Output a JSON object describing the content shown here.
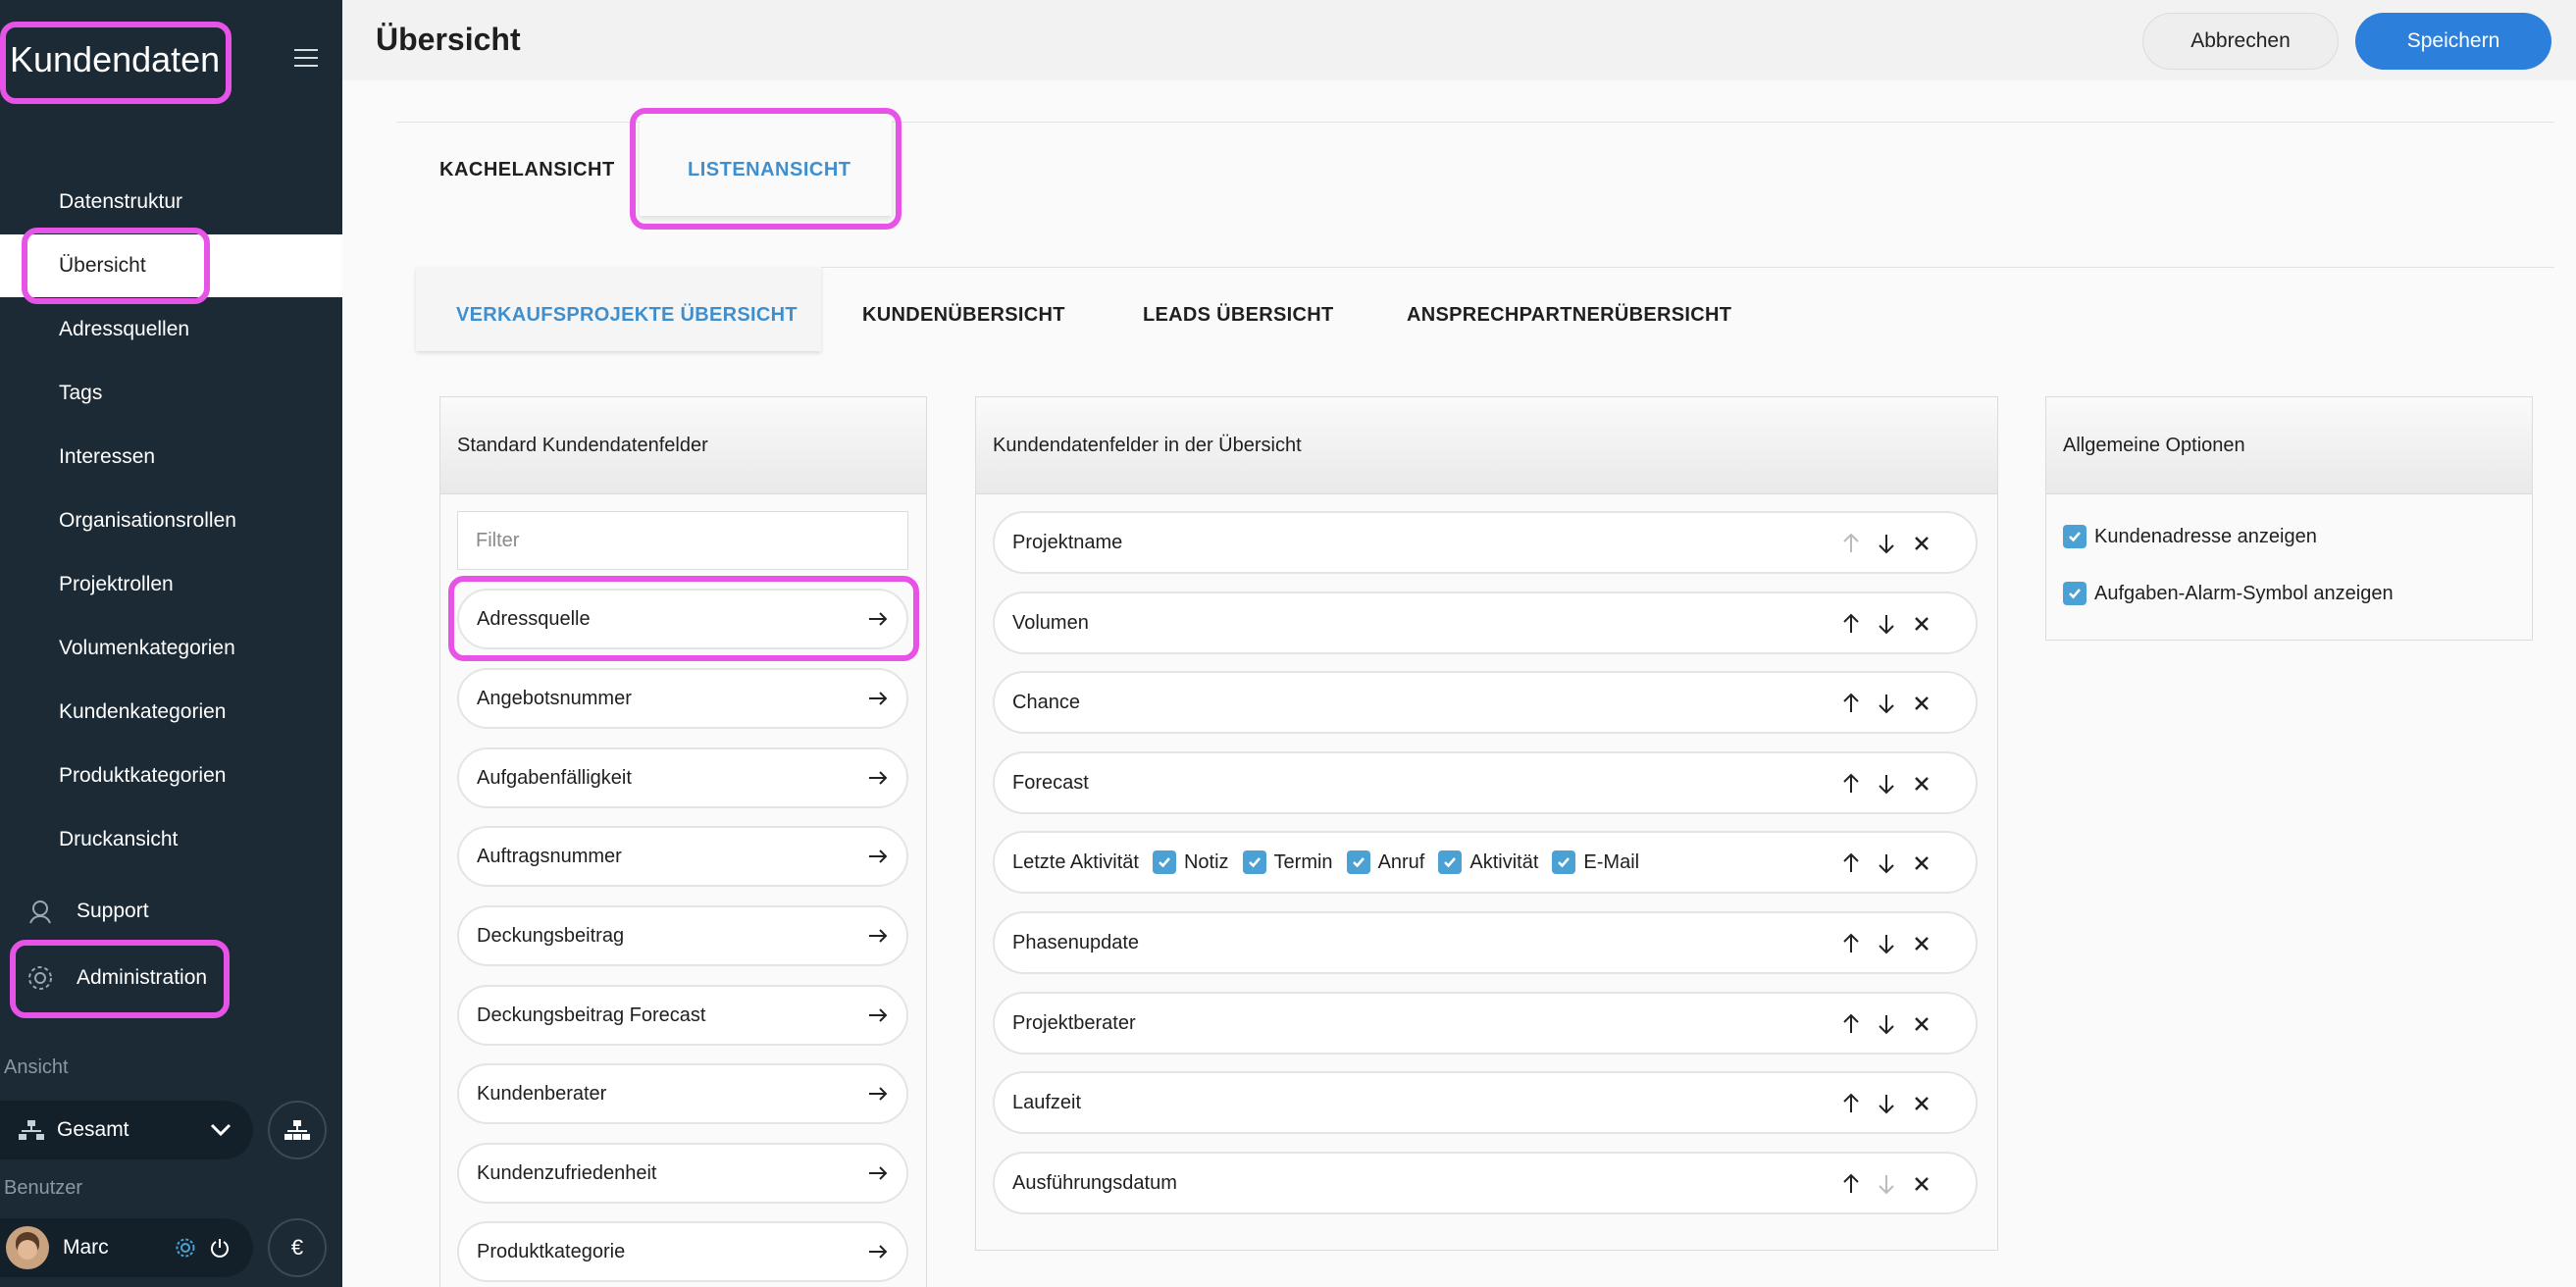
{
  "sidebar": {
    "app_title": "Kundendaten",
    "items": [
      {
        "label": "Datenstruktur"
      },
      {
        "label": "Übersicht"
      },
      {
        "label": "Adressquellen"
      },
      {
        "label": "Tags"
      },
      {
        "label": "Interessen"
      },
      {
        "label": "Organisationsrollen"
      },
      {
        "label": "Projektrollen"
      },
      {
        "label": "Volumenkategorien"
      },
      {
        "label": "Kundenkategorien"
      },
      {
        "label": "Produktkategorien"
      },
      {
        "label": "Druckansicht"
      }
    ],
    "support_label": "Support",
    "administration_label": "Administration",
    "view_label": "Ansicht",
    "view_value": "Gesamt",
    "user_section_label": "Benutzer",
    "user_name": "Marc",
    "currency_symbol": "€"
  },
  "header": {
    "title": "Übersicht",
    "cancel_label": "Abbrechen",
    "save_label": "Speichern"
  },
  "view_tabs": [
    {
      "label": "KACHELANSICHT"
    },
    {
      "label": "LISTENANSICHT",
      "active": true
    }
  ],
  "sub_tabs": [
    {
      "label": "VERKAUFSPROJEKTE ÜBERSICHT",
      "active": true
    },
    {
      "label": "KUNDENÜBERSICHT"
    },
    {
      "label": "LEADS ÜBERSICHT"
    },
    {
      "label": "ANSPRECHPARTNERÜBERSICHT"
    }
  ],
  "standard_panel": {
    "title": "Standard Kundendatenfelder",
    "filter_placeholder": "Filter",
    "items": [
      "Adressquelle",
      "Angebotsnummer",
      "Aufgabenfälligkeit",
      "Auftragsnummer",
      "Deckungsbeitrag",
      "Deckungsbeitrag Forecast",
      "Kundenberater",
      "Kundenzufriedenheit",
      "Produktkategorie"
    ]
  },
  "overview_panel": {
    "title": "Kundendatenfelder in der Übersicht",
    "items": [
      {
        "label": "Projektname"
      },
      {
        "label": "Volumen"
      },
      {
        "label": "Chance"
      },
      {
        "label": "Forecast"
      },
      {
        "label": "Letzte Aktivität",
        "options": [
          "Notiz",
          "Termin",
          "Anruf",
          "Aktivität",
          "E-Mail"
        ]
      },
      {
        "label": "Phasenupdate"
      },
      {
        "label": "Projektberater"
      },
      {
        "label": "Laufzeit"
      },
      {
        "label": "Ausführungsdatum"
      }
    ]
  },
  "options_panel": {
    "title": "Allgemeine Optionen",
    "options": [
      {
        "label": "Kundenadresse anzeigen",
        "checked": true
      },
      {
        "label": "Aufgaben-Alarm-Symbol anzeigen",
        "checked": true
      }
    ]
  },
  "colors": {
    "sidebar_bg": "#1b2a35",
    "accent": "#2d7fdc",
    "active_tab": "#3f8fce",
    "checkbox": "#4ba1d4",
    "highlight": "#e653e6"
  }
}
